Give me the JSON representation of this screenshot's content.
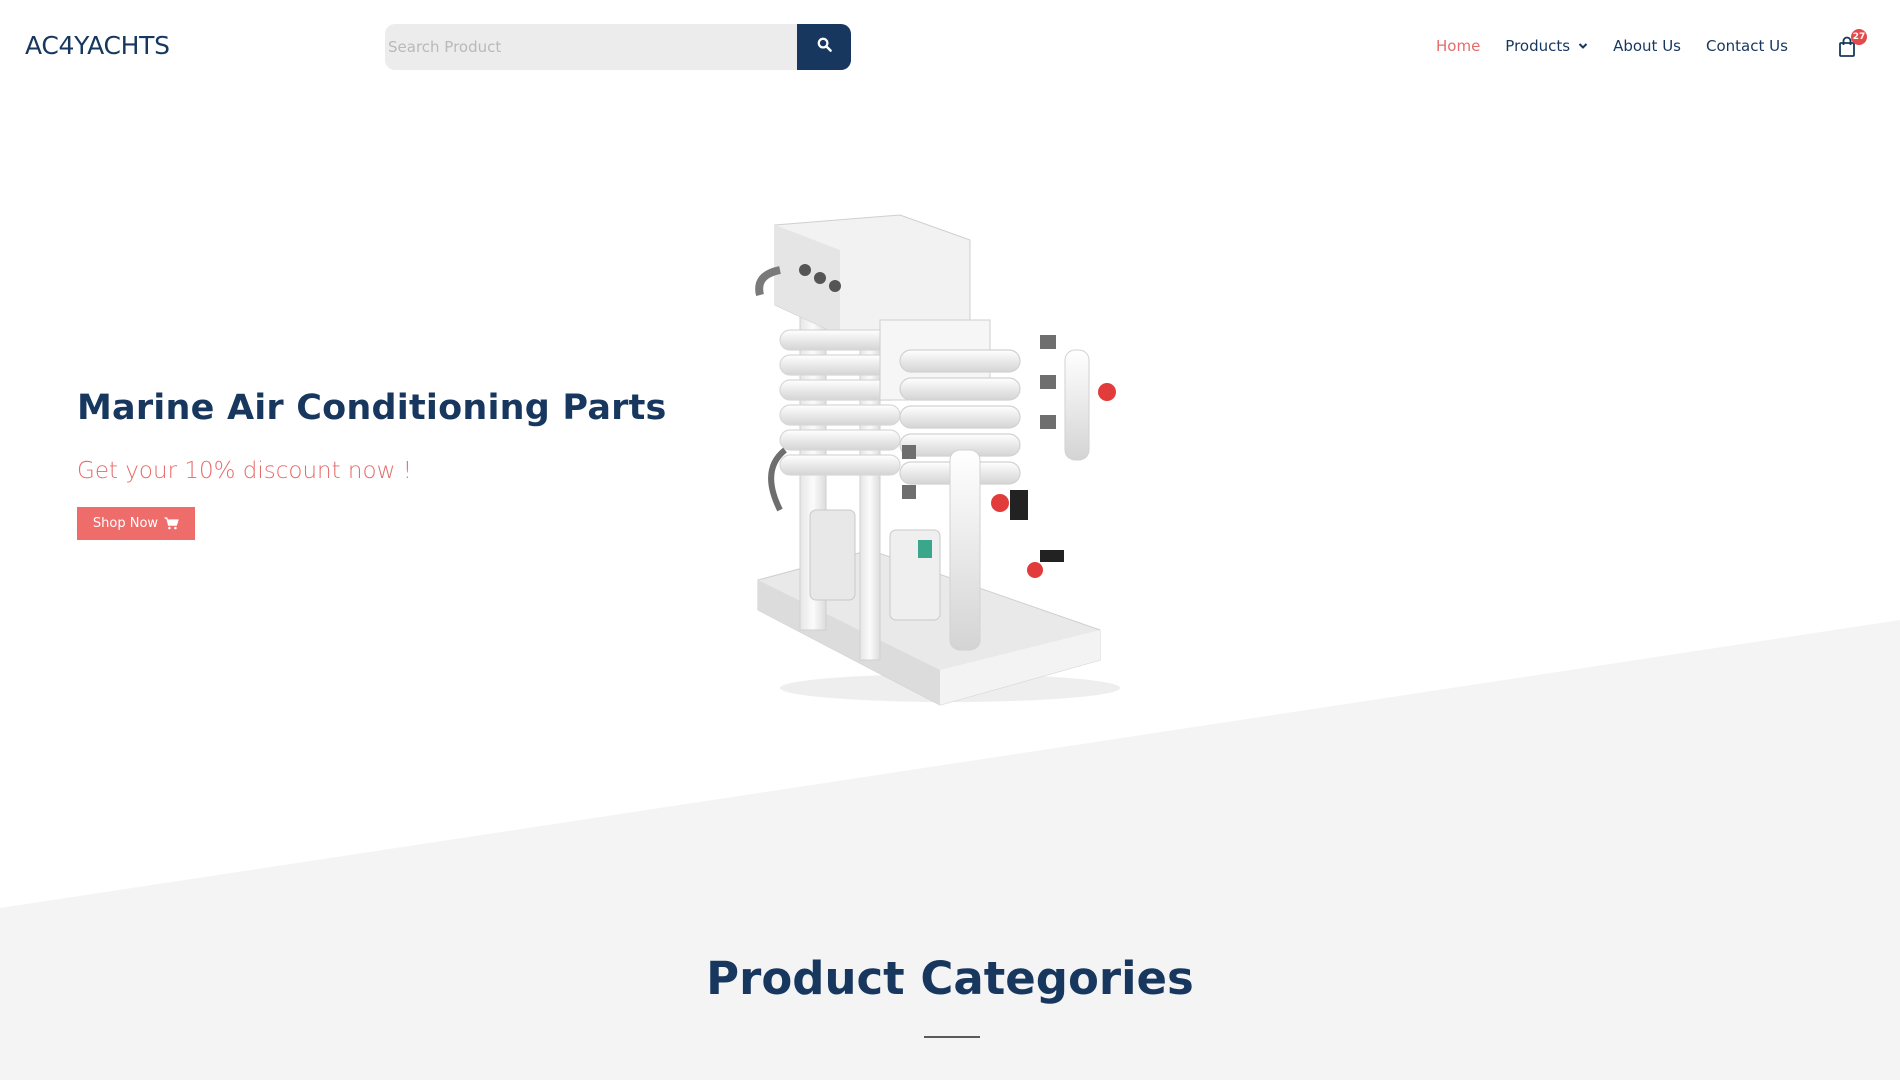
{
  "header": {
    "logo": "AC4YACHTS",
    "search": {
      "placeholder": "Search Product",
      "value": ""
    },
    "nav": {
      "home": "Home",
      "products": "Products",
      "about": "About Us",
      "contact": "Contact Us"
    },
    "cart_count": "27"
  },
  "hero": {
    "title": "Marine Air Conditioning Parts",
    "subtitle": "Get your 10% discount now !",
    "shop_label": "Shop Now"
  },
  "categories": {
    "title": "Product Categories"
  },
  "colors": {
    "navy": "#17375e",
    "accent": "#e66b6b",
    "button": "#ee6c6a",
    "band": "#f4f4f4"
  },
  "icons": {
    "search": "search-icon",
    "cart": "shopping-bag-icon",
    "shop": "cart-icon",
    "dropdown": "chevron-down-icon"
  }
}
